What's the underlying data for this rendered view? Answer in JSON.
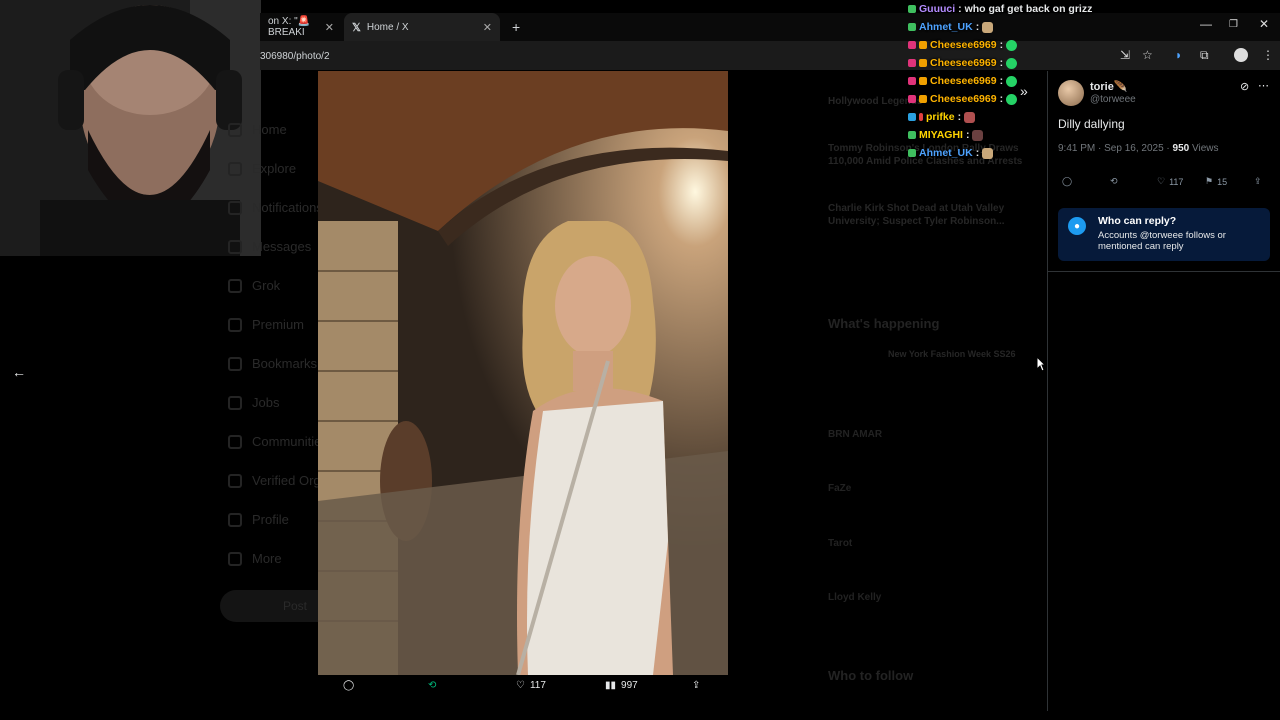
{
  "browser": {
    "tabs": [
      {
        "label": "on X: \"🚨 BREAKI",
        "active": false
      },
      {
        "label": "Home / X",
        "active": true
      }
    ],
    "new_tab": "+",
    "url": "306980/photo/2",
    "window_controls": [
      "—",
      "❐",
      "✕"
    ]
  },
  "background_page": {
    "nav": [
      "Home",
      "Explore",
      "Notifications",
      "Messages",
      "Grok",
      "Premium",
      "Bookmarks",
      "Jobs",
      "Communities",
      "Verified Orgs",
      "Profile",
      "More"
    ],
    "post_button": "Post",
    "trends": [
      "Hollywood Legends",
      "Tommy Robinson's London Rally Draws 110,000 Amid Police Clashes and Arrests",
      "Charlie Kirk Shot Dead at Utah Valley University; Suspect Tyler Robinson..."
    ],
    "whats_happening": "What's happening",
    "happening_item": "New York Fashion Week SS26",
    "trend_names": [
      "BRN AMAR",
      "FaZe",
      "Tarot",
      "Lloyd Kelly"
    ],
    "who_to_follow": "Who to follow"
  },
  "viewer": {
    "back_icon": "arrow-left-icon",
    "likes": "117",
    "views": "997"
  },
  "tweet": {
    "display_name": "torie🪶",
    "handle": "@torweee",
    "text": "Dilly dallying",
    "time": "9:41 PM · Sep 16, 2025 · ",
    "views_count": "950",
    "views_label": " Views",
    "likes": "117",
    "bookmarks": "15",
    "who_can_reply_title": "Who can reply?",
    "who_can_reply_desc": "Accounts @torweee follows or mentioned can reply"
  },
  "chat": [
    {
      "user": "Guuuci",
      "text": " : who gaf get back on grizz",
      "color": "#b48cff"
    },
    {
      "user": "Ahmet_UK",
      "text": " :",
      "color": "#4ea3ff"
    },
    {
      "user": "Cheesee6969",
      "text": " :",
      "color": "#ffb400"
    },
    {
      "user": "Cheesee6969",
      "text": " :",
      "color": "#ffb400"
    },
    {
      "user": "Cheesee6969",
      "text": " :",
      "color": "#ffb400"
    },
    {
      "user": "Cheesee6969",
      "text": " :",
      "color": "#ffb400"
    },
    {
      "user": "prifke",
      "text": " :",
      "color": "#ffd400"
    },
    {
      "user": "MIYAGHI",
      "text": " :",
      "color": "#ffd400"
    },
    {
      "user": "Ahmet_UK",
      "text": " :",
      "color": "#4ea3ff"
    }
  ]
}
